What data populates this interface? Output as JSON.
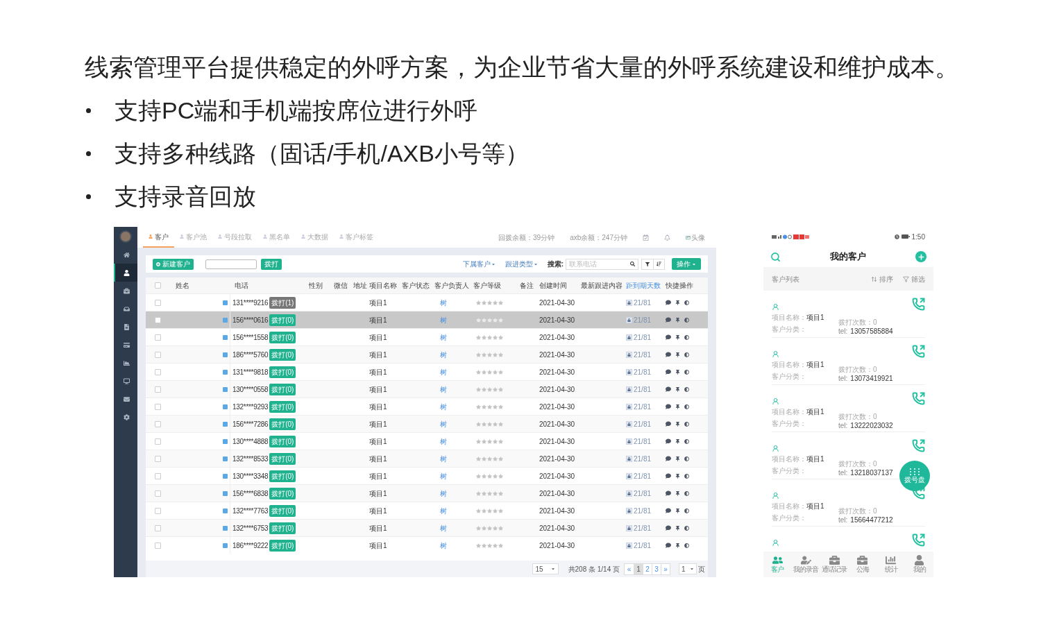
{
  "slide": {
    "title": "线索管理平台提供稳定的外呼方案，为企业节省大量的外呼系统建设和维护成本。",
    "bullets": [
      "支持PC端和手机端按席位进行外呼",
      "支持多种线路（固话/手机/AXB小号等）",
      "支持录音回放"
    ]
  },
  "desktop": {
    "sidebar": [
      {
        "kind": "home",
        "selected": false
      },
      {
        "kind": "user",
        "selected": true
      },
      {
        "kind": "briefcase",
        "selected": false
      },
      {
        "kind": "inbox",
        "selected": false
      },
      {
        "kind": "file",
        "selected": false
      },
      {
        "kind": "card",
        "selected": false
      },
      {
        "kind": "chart",
        "selected": false
      },
      {
        "kind": "monitor",
        "selected": false
      },
      {
        "kind": "mail",
        "selected": false
      },
      {
        "kind": "settings",
        "selected": false
      }
    ],
    "tabs": [
      {
        "label": "客户",
        "selected": true
      },
      {
        "label": "客户池",
        "selected": false
      },
      {
        "label": "号段拉取",
        "selected": false
      },
      {
        "label": "黑名单",
        "selected": false
      },
      {
        "label": "大数据",
        "selected": false
      },
      {
        "label": "客户标签",
        "selected": false
      }
    ],
    "balances": [
      "回拨余额：39分钟",
      "axb余额：247分钟"
    ],
    "avatar_alt": "头像",
    "toolbar": {
      "new_button": "新建客户",
      "call_button": "拨打",
      "filters": [
        "下属客户",
        "跟进类型"
      ],
      "search_label": "搜索:",
      "search_placeholder": "联系电话",
      "action_button": "操作"
    },
    "table": {
      "select_all_checked": false,
      "columns": [
        {
          "label": "姓名",
          "link": false
        },
        {
          "label": "电话",
          "link": false
        },
        {
          "label": "性别",
          "link": false
        },
        {
          "label": "微信",
          "link": false
        },
        {
          "label": "地址",
          "link": false
        },
        {
          "label": "项目名称",
          "link": false
        },
        {
          "label": "客户状态",
          "link": false
        },
        {
          "label": "客户负责人",
          "link": false
        },
        {
          "label": "客户等级",
          "link": false
        },
        {
          "label": "备注",
          "link": false
        },
        {
          "label": "创建时间",
          "link": false
        },
        {
          "label": "最新跟进内容",
          "link": false
        },
        {
          "label": "距到期天数",
          "link": true
        },
        {
          "label": "快捷操作",
          "link": false
        }
      ],
      "rows": [
        {
          "phone": "131****9216",
          "call_label": "拨打(1)",
          "called": true,
          "project": "项目1",
          "owner": "树",
          "stars": 0,
          "created": "2021-04-30",
          "days": "21/81",
          "checked": false,
          "selected": false
        },
        {
          "phone": "156****0616",
          "call_label": "拨打(0)",
          "called": false,
          "project": "项目1",
          "owner": "树",
          "stars": 0,
          "created": "2021-04-30",
          "days": "21/81",
          "checked": false,
          "selected": true
        },
        {
          "phone": "156****1558",
          "call_label": "拨打(0)",
          "called": false,
          "project": "项目1",
          "owner": "树",
          "stars": 0,
          "created": "2021-04-30",
          "days": "21/81",
          "checked": false,
          "selected": false
        },
        {
          "phone": "186****5760",
          "call_label": "拨打(0)",
          "called": false,
          "project": "项目1",
          "owner": "树",
          "stars": 0,
          "created": "2021-04-30",
          "days": "21/81",
          "checked": false,
          "selected": false
        },
        {
          "phone": "131****9818",
          "call_label": "拨打(0)",
          "called": false,
          "project": "项目1",
          "owner": "树",
          "stars": 0,
          "created": "2021-04-30",
          "days": "21/81",
          "checked": false,
          "selected": false
        },
        {
          "phone": "130****0558",
          "call_label": "拨打(0)",
          "called": false,
          "project": "项目1",
          "owner": "树",
          "stars": 0,
          "created": "2021-04-30",
          "days": "21/81",
          "checked": false,
          "selected": false
        },
        {
          "phone": "132****9293",
          "call_label": "拨打(0)",
          "called": false,
          "project": "项目1",
          "owner": "树",
          "stars": 0,
          "created": "2021-04-30",
          "days": "21/81",
          "checked": false,
          "selected": false
        },
        {
          "phone": "156****7286",
          "call_label": "拨打(0)",
          "called": false,
          "project": "项目1",
          "owner": "树",
          "stars": 0,
          "created": "2021-04-30",
          "days": "21/81",
          "checked": false,
          "selected": false
        },
        {
          "phone": "130****4888",
          "call_label": "拨打(0)",
          "called": false,
          "project": "项目1",
          "owner": "树",
          "stars": 0,
          "created": "2021-04-30",
          "days": "21/81",
          "checked": false,
          "selected": false
        },
        {
          "phone": "132****8533",
          "call_label": "拨打(0)",
          "called": false,
          "project": "项目1",
          "owner": "树",
          "stars": 0,
          "created": "2021-04-30",
          "days": "21/81",
          "checked": false,
          "selected": false
        },
        {
          "phone": "130****3348",
          "call_label": "拨打(0)",
          "called": false,
          "project": "项目1",
          "owner": "树",
          "stars": 0,
          "created": "2021-04-30",
          "days": "21/81",
          "checked": false,
          "selected": false
        },
        {
          "phone": "156****6838",
          "call_label": "拨打(0)",
          "called": false,
          "project": "项目1",
          "owner": "树",
          "stars": 0,
          "created": "2021-04-30",
          "days": "21/81",
          "checked": false,
          "selected": false
        },
        {
          "phone": "132****7763",
          "call_label": "拨打(0)",
          "called": false,
          "project": "项目1",
          "owner": "树",
          "stars": 0,
          "created": "2021-04-30",
          "days": "21/81",
          "checked": false,
          "selected": false
        },
        {
          "phone": "132****6753",
          "call_label": "拨打(0)",
          "called": false,
          "project": "项目1",
          "owner": "树",
          "stars": 0,
          "created": "2021-04-30",
          "days": "21/81",
          "checked": false,
          "selected": false
        },
        {
          "phone": "186****9222",
          "call_label": "拨打(0)",
          "called": false,
          "project": "项目1",
          "owner": "树",
          "stars": 0,
          "created": "2021-04-30",
          "days": "21/81",
          "checked": false,
          "selected": false
        }
      ]
    },
    "pagination": {
      "page_size": "15",
      "summary": "共208 条 1/14 页",
      "prev": "«",
      "pages": [
        {
          "label": "1",
          "selected": true
        },
        {
          "label": "2",
          "selected": false
        },
        {
          "label": "3",
          "selected": false
        }
      ],
      "next": "»",
      "jump": "1",
      "jump_unit": "页"
    }
  },
  "mobile": {
    "time": "1:50",
    "title": "我的客户",
    "list_label": "客户列表",
    "sort": "排序",
    "filter": "筛选",
    "cards": [
      {
        "kind": "full",
        "project_label": "项目名称：",
        "project": "项目1",
        "category_label": "客户分类：",
        "calls_label": "拨打次数：",
        "calls": "0",
        "tel_label": "tel:",
        "tel": "13057585884"
      },
      {
        "kind": "full",
        "project_label": "项目名称：",
        "project": "项目1",
        "category_label": "客户分类：",
        "calls_label": "拨打次数：",
        "calls": "0",
        "tel_label": "tel:",
        "tel": "13073419921"
      },
      {
        "kind": "full",
        "project_label": "项目名称：",
        "project": "项目1",
        "category_label": "客户分类：",
        "calls_label": "拨打次数：",
        "calls": "0",
        "tel_label": "tel:",
        "tel": "13222023032"
      },
      {
        "kind": "full",
        "project_label": "项目名称：",
        "project": "项目1",
        "category_label": "客户分类：",
        "calls_label": "拨打次数：",
        "calls": "0",
        "tel_label": "tel:",
        "tel": "13218037137"
      },
      {
        "kind": "full",
        "project_label": "项目名称：",
        "project": "项目1",
        "category_label": "客户分类：",
        "calls_label": "拨打次数：",
        "calls": "0",
        "tel_label": "tel:",
        "tel": "15664477212"
      },
      {
        "kind": "partial"
      }
    ],
    "dialpad": "拨号盘",
    "tabs": [
      {
        "kind": "customers",
        "label": "客户",
        "selected": true
      },
      {
        "kind": "recordings",
        "label": "我的录音",
        "selected": false
      },
      {
        "kind": "calls",
        "label": "通话记录",
        "selected": false
      },
      {
        "kind": "sea",
        "label": "公海",
        "selected": false
      },
      {
        "kind": "stats",
        "label": "统计",
        "selected": false
      },
      {
        "kind": "me",
        "label": "我的",
        "selected": false
      }
    ]
  }
}
